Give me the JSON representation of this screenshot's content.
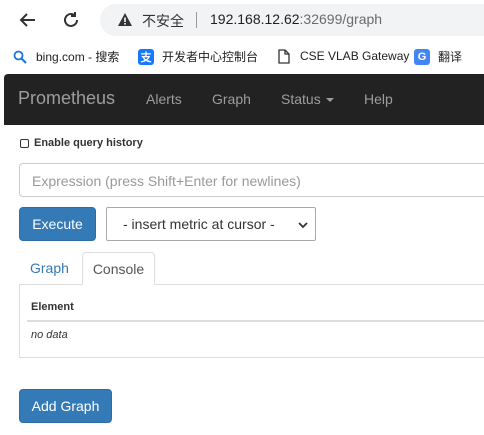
{
  "browser": {
    "insecure_label": "不安全",
    "url_host": "192.168.12.62",
    "url_rest": ":32699/graph",
    "bookmarks": [
      {
        "label": "bing.com - 搜索",
        "icon": "bing-search-icon"
      },
      {
        "label": "开发者中心控制台",
        "icon": "alipay-icon"
      },
      {
        "label": "CSE VLAB Gateway",
        "icon": "document-icon"
      },
      {
        "label": "翻译",
        "icon": "google-translate-icon"
      }
    ]
  },
  "navbar": {
    "brand": "Prometheus",
    "items": [
      "Alerts",
      "Graph",
      "Status",
      "Help"
    ]
  },
  "query": {
    "history_label": "Enable query history",
    "history_checked": false,
    "expression_placeholder": "Expression (press Shift+Enter for newlines)",
    "execute_label": "Execute",
    "metric_select_value": "- insert metric at cursor -"
  },
  "tabs": {
    "graph": "Graph",
    "console": "Console",
    "active": "Console"
  },
  "console_table": {
    "header": "Element",
    "empty_text": "no data"
  },
  "add_graph_label": "Add Graph",
  "colors": {
    "navbar_bg": "#222222",
    "primary_button": "#337ab7",
    "link": "#337ab7"
  }
}
